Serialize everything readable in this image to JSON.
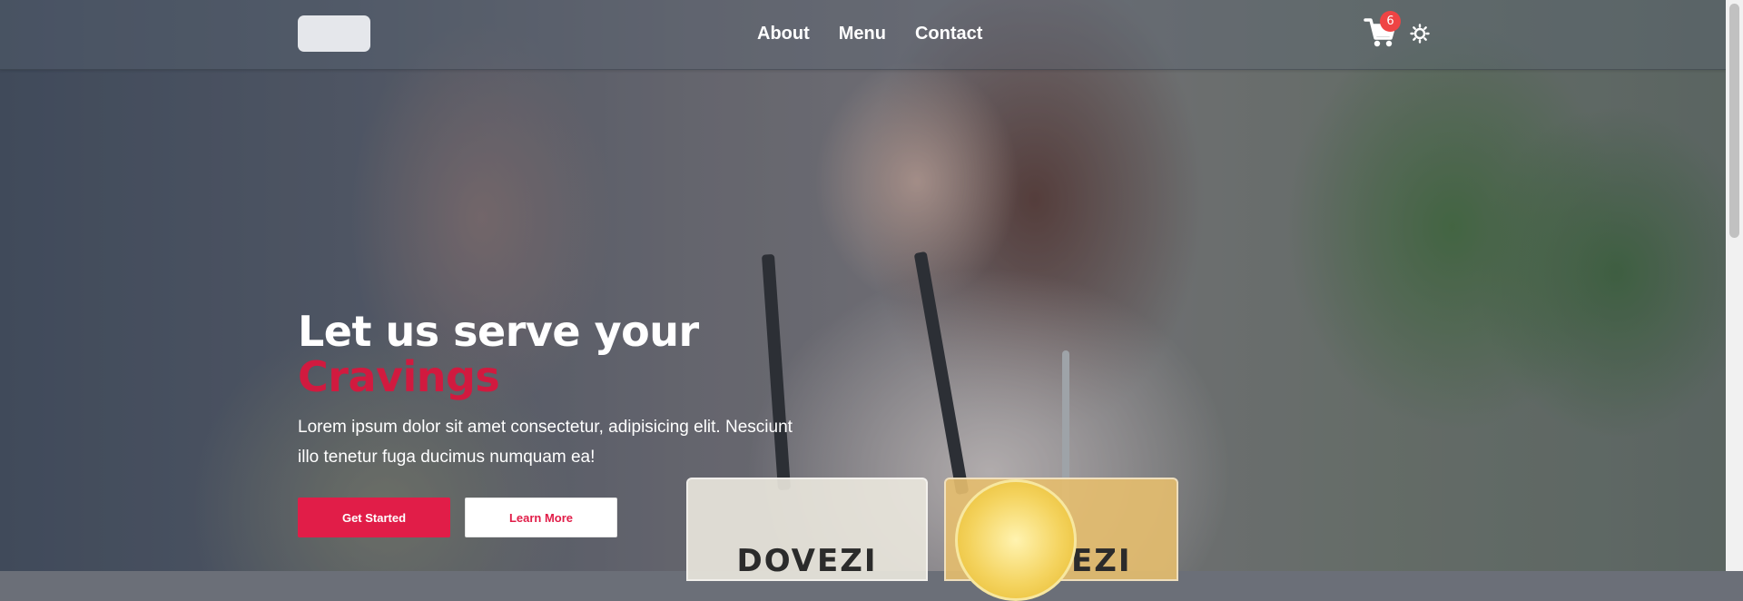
{
  "header": {
    "nav": [
      {
        "label": "About"
      },
      {
        "label": "Menu"
      },
      {
        "label": "Contact"
      }
    ],
    "cart": {
      "icon": "cart-icon",
      "count": "6"
    },
    "theme_toggle": {
      "icon": "sun-icon"
    }
  },
  "hero": {
    "title_line1": "Let us serve your",
    "title_line2": "Cravings",
    "description": "Lorem ipsum dolor sit amet consectetur, adipisicing elit. Nesciunt illo tenetur fuga ducimus numquam ea!",
    "primary_button": "Get Started",
    "secondary_button": "Learn More",
    "drink_brand_left": "DOVEZI",
    "drink_brand_right": "DOVEZI"
  },
  "colors": {
    "accent": "#e11d48",
    "title_accent": "#d11a3f",
    "badge": "#ef4444"
  }
}
